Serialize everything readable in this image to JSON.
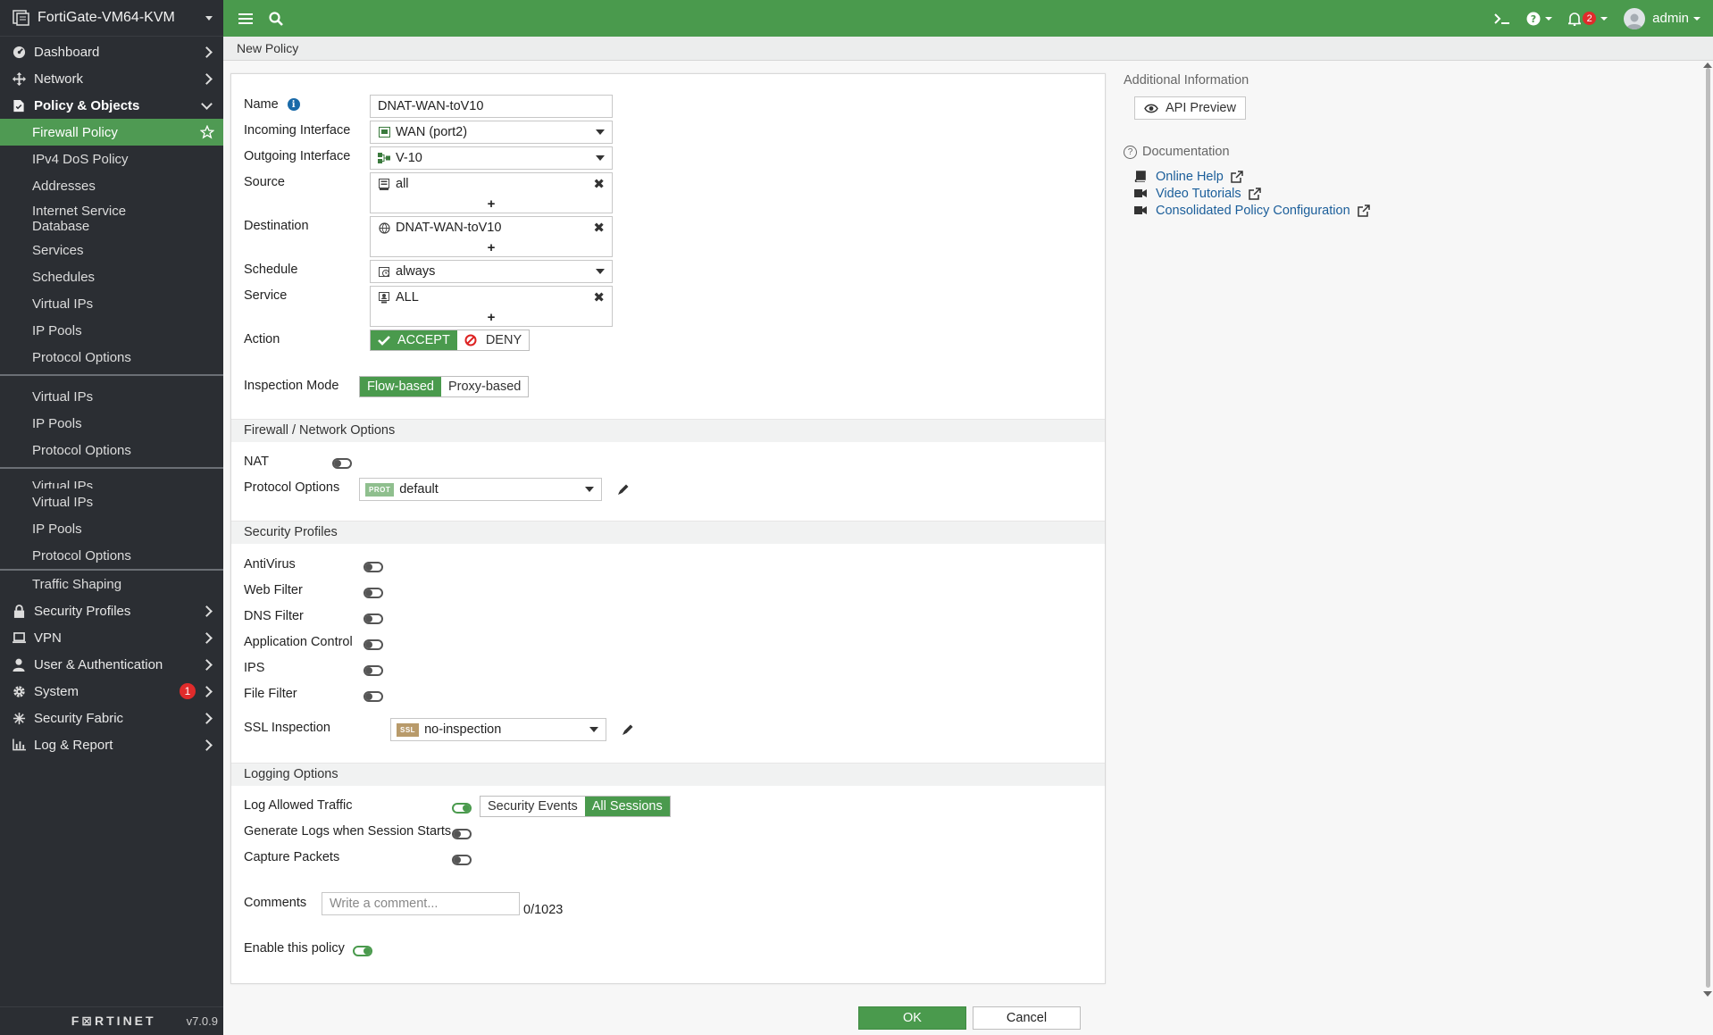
{
  "device": {
    "name": "FortiGate-VM64-KVM",
    "version": "v7.0.9",
    "logo": "F⊠RTINET"
  },
  "nav": {
    "dashboard": "Dashboard",
    "network": "Network",
    "policy_objects": "Policy & Objects",
    "sub": {
      "firewall_policy": "Firewall Policy",
      "ipv4_dos": "IPv4 DoS Policy",
      "addresses": "Addresses",
      "isdb_line1": "Internet Service",
      "isdb_line2": "Database",
      "services": "Services",
      "schedules": "Schedules",
      "virtual_ips": "Virtual IPs",
      "ip_pools": "IP Pools",
      "protocol_options": "Protocol Options",
      "traffic_shaping": "Traffic Shaping",
      "cut_label": "Virtual IPs"
    },
    "security_profiles": "Security Profiles",
    "vpn": "VPN",
    "user_auth": "User & Authentication",
    "system": "System",
    "system_badge": "1",
    "security_fabric": "Security Fabric",
    "log_report": "Log & Report"
  },
  "topbar": {
    "alert_count": "2",
    "user": "admin"
  },
  "breadcrumb": "New Policy",
  "form": {
    "name_label": "Name",
    "name_value": "DNAT-WAN-toV10",
    "incoming_label": "Incoming Interface",
    "incoming_value": "WAN (port2)",
    "outgoing_label": "Outgoing Interface",
    "outgoing_value": "V-10",
    "source_label": "Source",
    "source_value": "all",
    "destination_label": "Destination",
    "destination_value": "DNAT-WAN-toV10",
    "schedule_label": "Schedule",
    "schedule_value": "always",
    "service_label": "Service",
    "service_value": "ALL",
    "action_label": "Action",
    "accept": "ACCEPT",
    "deny": "DENY",
    "inspection_label": "Inspection Mode",
    "flow": "Flow-based",
    "proxy": "Proxy-based",
    "plus": "+",
    "remove": "✖"
  },
  "fw_section": {
    "title": "Firewall / Network Options",
    "nat": "NAT",
    "protocol_options": "Protocol Options",
    "prot_tag": "PROT",
    "prot_value": "default"
  },
  "sec_section": {
    "title": "Security Profiles",
    "antivirus": "AntiVirus",
    "web_filter": "Web Filter",
    "dns_filter": "DNS Filter",
    "app_control": "Application Control",
    "ips": "IPS",
    "file_filter": "File Filter",
    "ssl_label": "SSL Inspection",
    "ssl_tag": "SSL",
    "ssl_value": "no-inspection"
  },
  "log_section": {
    "title": "Logging Options",
    "log_allowed": "Log Allowed Traffic",
    "security_events": "Security Events",
    "all_sessions": "All Sessions",
    "gen_logs": "Generate Logs when Session Starts",
    "capture": "Capture Packets"
  },
  "comments": {
    "label": "Comments",
    "placeholder": "Write a comment...",
    "counter": "0/1023"
  },
  "enable_policy": "Enable this policy",
  "info": {
    "title": "Additional Information",
    "api_preview": "API Preview",
    "documentation": "Documentation",
    "online_help": "Online Help",
    "video_tutorials": "Video Tutorials",
    "consolidated": "Consolidated Policy Configuration"
  },
  "buttons": {
    "ok": "OK",
    "cancel": "Cancel"
  },
  "colors": {
    "accent": "#4a9a4d",
    "sidebar": "#2b2e33",
    "link": "#1b5e9a",
    "alert": "#e02b2b"
  }
}
